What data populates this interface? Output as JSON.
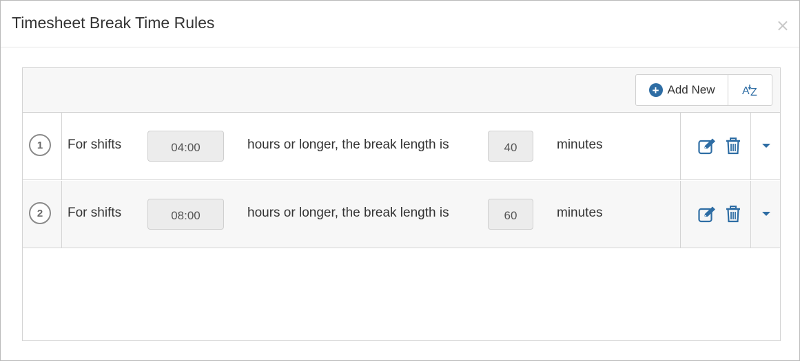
{
  "dialog": {
    "title": "Timesheet Break Time Rules",
    "close_glyph": "×"
  },
  "toolbar": {
    "add_new_label": "Add New",
    "add_new_icon": "plus-circle-icon",
    "sort_label": "AZ",
    "sort_icon": "sort-alpha-icon"
  },
  "rules": [
    {
      "number": "1",
      "prefix": "For shifts",
      "hours_value": "04:00",
      "middle": "hours or longer, the break length is",
      "minutes_value": "40",
      "suffix": "minutes"
    },
    {
      "number": "2",
      "prefix": "For shifts",
      "hours_value": "08:00",
      "middle": "hours or longer, the break length is",
      "minutes_value": "60",
      "suffix": "minutes"
    }
  ],
  "colors": {
    "accent": "#2e6da4",
    "row_alt_bg": "#f7f7f7",
    "border": "#d4d4d4"
  }
}
